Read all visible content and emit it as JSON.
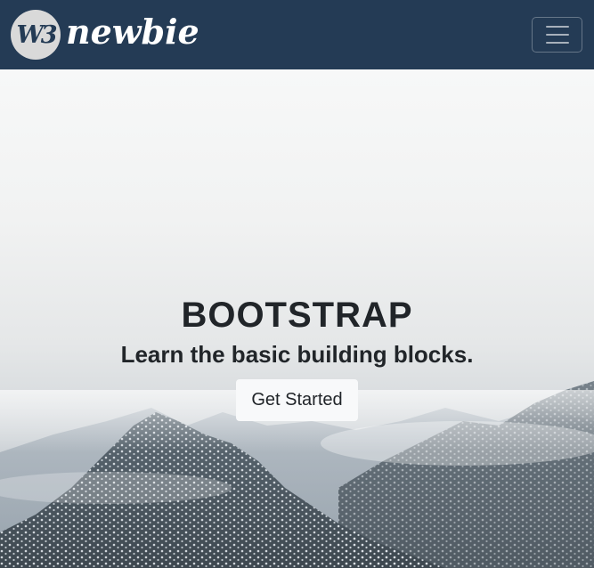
{
  "navbar": {
    "logo_mark": "W3",
    "logo_text": "newbie",
    "toggler_label": "Toggle navigation"
  },
  "hero": {
    "title": "BOOTSTRAP",
    "subtitle": "Learn the basic building blocks.",
    "cta_label": "Get Started"
  },
  "colors": {
    "navbar_bg": "#243b55",
    "text_dark": "#212529",
    "button_bg": "#f8f9fa"
  }
}
